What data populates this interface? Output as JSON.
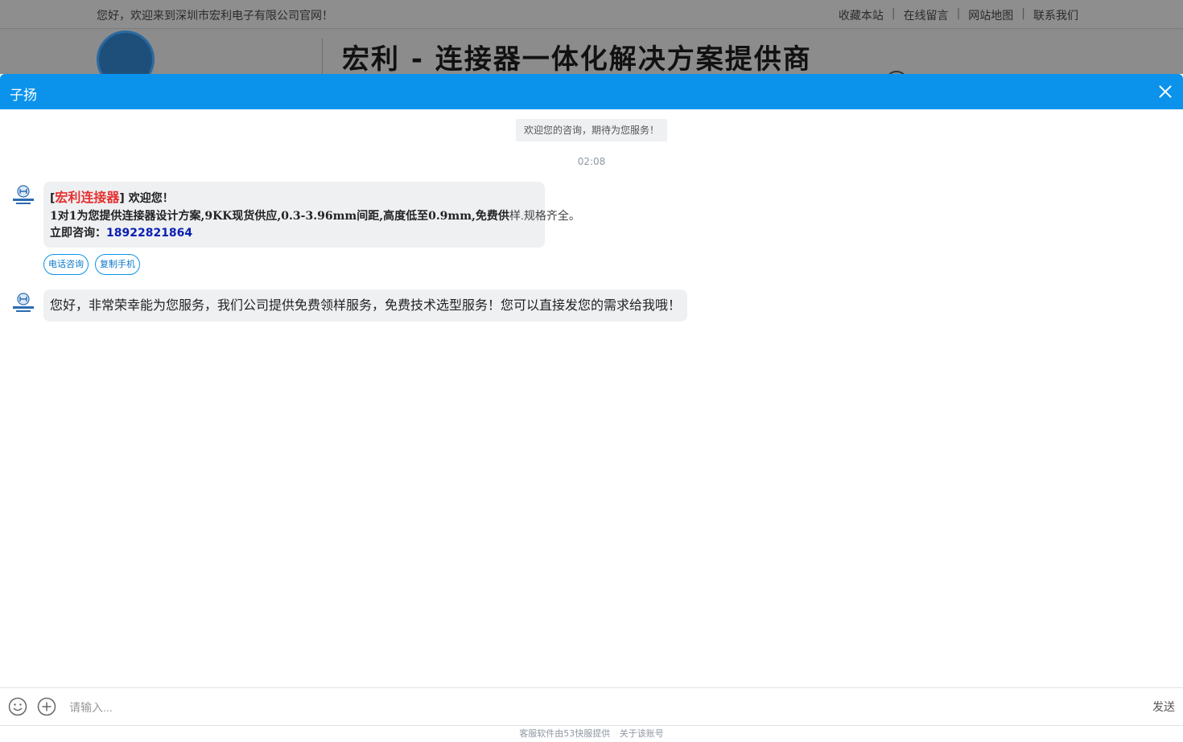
{
  "site": {
    "welcome": "您好，欢迎来到深圳市宏利电子有限公司官网！",
    "links": [
      "收藏本站",
      "在线留言",
      "网站地图",
      "联系我们"
    ],
    "slogan": "宏利 - 连接器一体化解决方案提供商"
  },
  "chat": {
    "agent_name": "子扬",
    "system_note": "欢迎您的咨询，期待为您服务！",
    "timestamp": "02:08",
    "message1": {
      "brand_open": "[",
      "brand": "宏利连接器",
      "greeting": "] 欢迎您！",
      "line2_main": "1对1为您提供连接器设计方案,9KK现货供应,0.3-3.96mm间距,高度低至0.9mm,免费供",
      "line2_tail": "样.规格齐全。",
      "line3_label": "立即咨询：",
      "line3_phone": "18922821864"
    },
    "chips": [
      "电话咨询",
      "复制手机"
    ],
    "message2": "您好，非常荣幸能为您服务，我们公司提供免费领样服务，免费技术选型服务！您可以直接发您的需求给我哦！",
    "input_placeholder": "请输入...",
    "send_label": "发送",
    "footer": [
      "客服软件由53快服提供",
      "关于该账号"
    ]
  },
  "colors": {
    "header_blue": "#0b93ec",
    "brand_red": "#e53030",
    "phone_blue": "#0a1fb0"
  }
}
